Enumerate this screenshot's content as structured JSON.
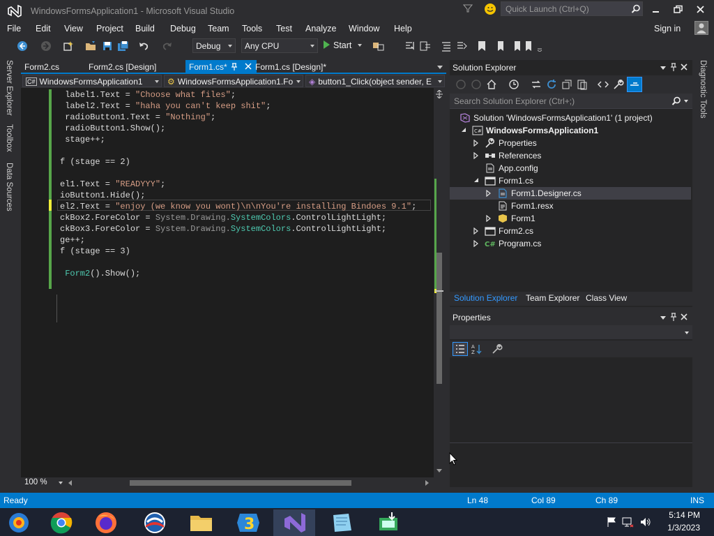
{
  "window": {
    "title": "WindowsFormsApplication1 - Microsoft Visual Studio",
    "quick_launch_placeholder": "Quick Launch (Ctrl+Q)"
  },
  "menu": [
    "File",
    "Edit",
    "View",
    "Project",
    "Build",
    "Debug",
    "Team",
    "Tools",
    "Test",
    "Analyze",
    "Window",
    "Help"
  ],
  "signin": "Sign in",
  "toolbar": {
    "config": "Debug",
    "platform": "Any CPU",
    "start": "Start"
  },
  "left_strip": [
    "Server Explorer",
    "Toolbox",
    "Data Sources"
  ],
  "right_strip": [
    "Diagnostic Tools"
  ],
  "doc_tabs": [
    {
      "label": "Form2.cs",
      "active": false
    },
    {
      "label": "Form2.cs [Design]",
      "active": false
    },
    {
      "label": "Form1.cs*",
      "active": true
    },
    {
      "label": "Form1.cs [Design]*",
      "active": false
    }
  ],
  "nav": {
    "project": "WindowsFormsApplication1",
    "class": "WindowsFormsApplication1.Fo",
    "member": "button1_Click(object sender, E"
  },
  "code_lines": [
    {
      "parts": [
        [
          "label1.Text = ",
          ""
        ],
        [
          "\"Choose what files\"",
          "str"
        ],
        [
          ";",
          ""
        ]
      ],
      "indent": 1
    },
    {
      "parts": [
        [
          "label2.Text = ",
          ""
        ],
        [
          "\"haha you can't keep shit\"",
          "str"
        ],
        [
          ";",
          ""
        ]
      ],
      "indent": 1
    },
    {
      "parts": [
        [
          "radioButton1.Text = ",
          ""
        ],
        [
          "\"Nothing\"",
          "str"
        ],
        [
          ";",
          ""
        ]
      ],
      "indent": 1
    },
    {
      "parts": [
        [
          "radioButton1.Show();",
          ""
        ]
      ],
      "indent": 1
    },
    {
      "parts": [
        [
          "stage++;",
          ""
        ]
      ],
      "indent": 1
    },
    {
      "parts": [],
      "indent": 0
    },
    {
      "parts": [
        [
          "f (stage == 2)",
          ""
        ]
      ],
      "indent": 0
    },
    {
      "parts": [],
      "indent": 0
    },
    {
      "parts": [
        [
          "el1.Text = ",
          ""
        ],
        [
          "\"READYYY\"",
          "str"
        ],
        [
          ";",
          ""
        ]
      ],
      "indent": 0
    },
    {
      "parts": [
        [
          "ioButton1.Hide();",
          ""
        ]
      ],
      "indent": 0
    },
    {
      "parts": [
        [
          "el2.Text = ",
          ""
        ],
        [
          "\"enjoy (we know you wont)\\n\\nYou're installing Bindoes 9.1\"",
          "str"
        ],
        [
          ";",
          ""
        ]
      ],
      "indent": 0
    },
    {
      "parts": [
        [
          "ckBox2.ForeColor = ",
          ""
        ],
        [
          "System.Drawing.",
          "ns"
        ],
        [
          "SystemColors",
          "type"
        ],
        [
          ".ControlLightLight;",
          ""
        ]
      ],
      "indent": 0
    },
    {
      "parts": [
        [
          "ckBox3.ForeColor = ",
          ""
        ],
        [
          "System.Drawing.",
          "ns"
        ],
        [
          "SystemColors",
          "type"
        ],
        [
          ".ControlLightLight;",
          ""
        ]
      ],
      "indent": 0
    },
    {
      "parts": [
        [
          "ge++;",
          ""
        ]
      ],
      "indent": 0
    },
    {
      "parts": [
        [
          "f (stage == 3)",
          ""
        ]
      ],
      "indent": 0
    },
    {
      "parts": [],
      "indent": 0
    },
    {
      "parts": [
        [
          "Form2",
          "type"
        ],
        [
          "().Show();",
          ""
        ]
      ],
      "indent": 1
    }
  ],
  "zoom": "100 %",
  "solution_explorer": {
    "title": "Solution Explorer",
    "search_placeholder": "Search Solution Explorer (Ctrl+;)",
    "tree": [
      {
        "label": "Solution 'WindowsFormsApplication1' (1 project)",
        "level": 0,
        "expander": "",
        "icon": "solution-icon",
        "bold": false,
        "selected": false
      },
      {
        "label": "WindowsFormsApplication1",
        "level": 1,
        "expander": "open",
        "icon": "csharp-project-icon",
        "bold": true,
        "selected": false
      },
      {
        "label": "Properties",
        "level": 2,
        "expander": "closed",
        "icon": "wrench-icon",
        "bold": false,
        "selected": false
      },
      {
        "label": "References",
        "level": 2,
        "expander": "closed",
        "icon": "references-icon",
        "bold": false,
        "selected": false
      },
      {
        "label": "App.config",
        "level": 2,
        "expander": "",
        "icon": "config-file-icon",
        "bold": false,
        "selected": false
      },
      {
        "label": "Form1.cs",
        "level": 2,
        "expander": "open",
        "icon": "form-icon",
        "bold": false,
        "selected": false
      },
      {
        "label": "Form1.Designer.cs",
        "level": 3,
        "expander": "closed",
        "icon": "cs-file-icon",
        "bold": false,
        "selected": true
      },
      {
        "label": "Form1.resx",
        "level": 3,
        "expander": "",
        "icon": "resx-file-icon",
        "bold": false,
        "selected": false
      },
      {
        "label": "Form1",
        "level": 3,
        "expander": "closed",
        "icon": "class-icon",
        "bold": false,
        "selected": false
      },
      {
        "label": "Form2.cs",
        "level": 2,
        "expander": "closed",
        "icon": "form-icon",
        "bold": false,
        "selected": false
      },
      {
        "label": "Program.cs",
        "level": 2,
        "expander": "closed",
        "icon": "csharp-file-icon",
        "bold": false,
        "selected": false
      }
    ],
    "tabs": [
      "Solution Explorer",
      "Team Explorer",
      "Class View"
    ]
  },
  "properties": {
    "title": "Properties"
  },
  "status": {
    "state": "Ready",
    "ln": "Ln 48",
    "col": "Col 89",
    "ch": "Ch 89",
    "mode": "INS"
  },
  "taskbar": {
    "apps": [
      "explorer-media-icon",
      "chrome-icon",
      "firefox-icon",
      "obama-campaign-icon",
      "file-explorer-icon",
      "windows3-logo-icon",
      "visual-studio-icon",
      "notepad-icon",
      "download-manager-icon"
    ],
    "time": "5:14 PM",
    "date": "1/3/2023"
  },
  "colors": {
    "accent": "#007acc",
    "background": "#2d2d30",
    "editor": "#1e1e1e",
    "string": "#d69d85",
    "type": "#4ec9b0"
  }
}
